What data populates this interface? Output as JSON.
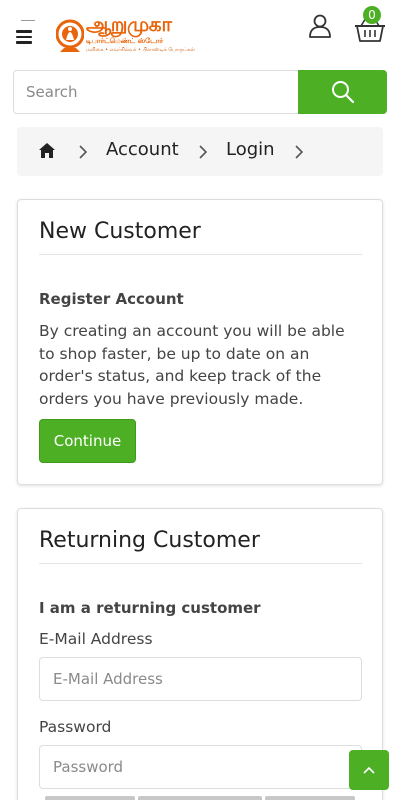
{
  "header": {
    "logo_title": "ஆறுமுகா",
    "logo_subtitle": "டிபார்ட்மெண்ட் ஸ்டோர்",
    "logo_tagline": "மளிகை • எவர்சில்வர் • பிளாஸ்டிக் பொருட்கள்",
    "cart_count": "0",
    "icons": [
      "menu-icon",
      "user-icon",
      "basket-icon"
    ]
  },
  "search": {
    "placeholder": "Search",
    "button_icon": "search-icon"
  },
  "breadcrumb": {
    "items": [
      {
        "label": "Account"
      },
      {
        "label": "Login"
      }
    ]
  },
  "new_customer": {
    "title": "New Customer",
    "subtitle": "Register Account",
    "description": "By creating an account you will be able to shop faster, be up to date on an order's status, and keep track of the orders you have previously made.",
    "button_label": "Continue"
  },
  "returning_customer": {
    "title": "Returning Customer",
    "subtitle": "I am a returning customer",
    "email_label": "E-Mail Address",
    "email_placeholder": "E-Mail Address",
    "password_label": "Password",
    "password_placeholder": "Password"
  },
  "colors": {
    "accent": "#4caf24",
    "logo_orange": "#e8650b",
    "breadcrumb_bg": "#f5f5f5"
  }
}
